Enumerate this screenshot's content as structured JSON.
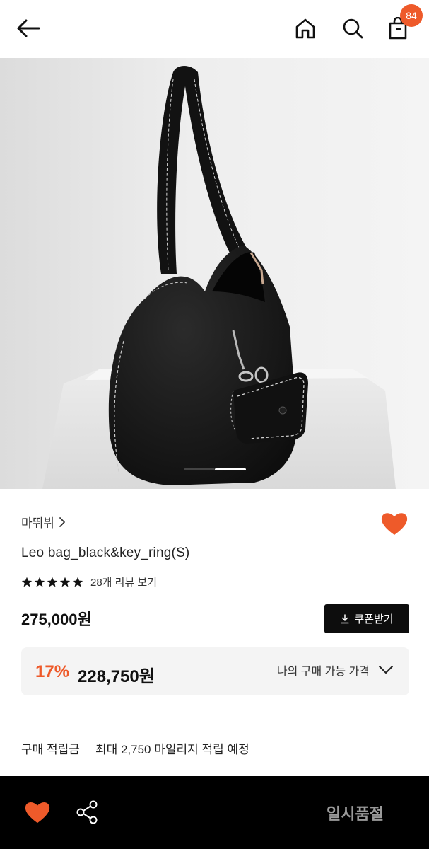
{
  "header": {
    "back_icon": "arrow-left-icon",
    "home_icon": "home-icon",
    "search_icon": "search-icon",
    "cart_icon": "shopping-bag-icon",
    "cart_count": "84"
  },
  "hero": {
    "image": "black leather hobo shoulder bag with key ring pouch",
    "slide_current": 1,
    "slide_total": 2
  },
  "product": {
    "brand": "마뛰뷔",
    "name": "Leo bag_black&key_ring(S)",
    "rating_stars": 5,
    "review_link": "28개 리뷰 보기",
    "price": "275,000원",
    "coupon_button": "쿠폰받기",
    "sale_percent": "17%",
    "sale_price": "228,750원",
    "sale_toggle_label": "나의 구매 가능 가격",
    "points_label": "구매 적립금",
    "points_value": "최대 2,750 마일리지 적립 예정"
  },
  "bottom_bar": {
    "wish_icon": "heart-icon",
    "share_icon": "share-icon",
    "status_button": "일시품절"
  },
  "colors": {
    "accent": "#ee5a2a",
    "badge": "#ee5a2a",
    "dark": "#0d0d0d",
    "sale_box_bg": "#f4f4f4"
  }
}
